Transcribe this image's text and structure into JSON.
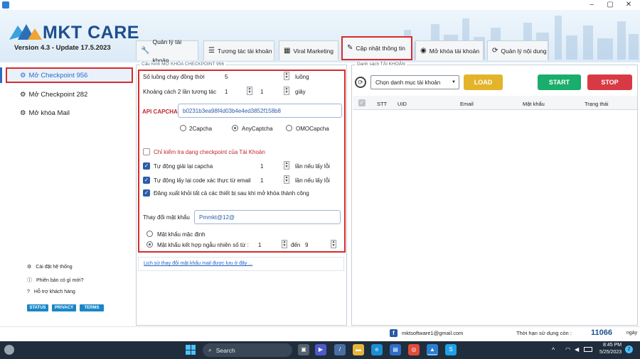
{
  "window": {
    "minimize": "–",
    "maximize": "▢",
    "close": "✕"
  },
  "brand": {
    "name": "MKT CARE",
    "version": "Version 4.3 - Update 17.5.2023"
  },
  "tabs": [
    {
      "label": "Quản lý tài khoản",
      "icon": "wrench-icon",
      "glyph": "🔧"
    },
    {
      "label": "Tương tác tài khoản",
      "icon": "list-icon",
      "glyph": "☰"
    },
    {
      "label": "Viral Marketing",
      "icon": "calendar-icon",
      "glyph": "▦"
    },
    {
      "label": "Cập nhật thông tin",
      "icon": "pencil-icon",
      "glyph": "✎"
    },
    {
      "label": "Mở khóa tài khoản",
      "icon": "user-icon",
      "glyph": "◉"
    },
    {
      "label": "Quản lý nội dung",
      "icon": "sync-icon",
      "glyph": "⟳"
    }
  ],
  "sidebar": {
    "items": [
      {
        "label": "Mở Checkpoint 956",
        "icon": "gear-icon",
        "glyph": "⚙"
      },
      {
        "label": "Mở Checkpoint 282",
        "icon": "gear-icon",
        "glyph": "⚙"
      },
      {
        "label": "Mở khóa Mail",
        "icon": "gear-icon",
        "glyph": "⚙"
      }
    ],
    "footer": [
      {
        "label": "Cài đặt hệ thống",
        "icon": "settings-icon",
        "glyph": "⚙"
      },
      {
        "label": "Phiên bản có gì mới?",
        "icon": "info-icon",
        "glyph": "ⓘ"
      },
      {
        "label": "Hỗ trợ khách hàng",
        "icon": "help-icon",
        "glyph": "?"
      }
    ],
    "pills": [
      "STATUS",
      "PRIVACY",
      "TERMS"
    ]
  },
  "config": {
    "legend": "Cấu hình MỞ KHÓA CHECKPOINT 956",
    "threads_label": "Số luồng chạy đồng thời",
    "threads_value": "5",
    "threads_unit": "luồng",
    "delay_label": "Khoảng cách 2 lần tương tác",
    "delay_from": "1",
    "delay_to": "1",
    "delay_unit": "giây",
    "api_label": "API CAPCHA",
    "api_value": "b0231b3ea98f4d03b4e4ed3852f158b8",
    "captcha_options": [
      "2Capcha",
      "AnyCaptcha",
      "OMOCapcha"
    ],
    "only_check_label": "Chỉ kiểm tra dạng checkpoint của Tài Khoản",
    "auto_captcha_label": "Tự động giải lại capcha",
    "auto_captcha_value": "1",
    "auto_captcha_unit": "lần nếu lấy lỗi",
    "auto_email_label": "Tự động lấy lại code xác thực từ email",
    "auto_email_value": "1",
    "auto_email_unit": "lần nếu lấy lỗi",
    "logout_label": "Đăng xuất khỏi tất cả các thiết bị sau khi mở khóa thành công",
    "pwd_label": "Thay đổi mật khẩu",
    "pwd_value": "Pmmkt@12@",
    "pwd_default_label": "Mật khẩu mặc định",
    "pwd_random_label": "Mật khẩu kết hợp ngẫu nhiên số từ :",
    "pwd_from": "1",
    "pwd_to_label": "đến",
    "pwd_to": "9",
    "history_link": "Lịch sử thay đổi mật khẩu mail được lưu ở đây ..."
  },
  "accounts": {
    "legend": "Danh sách TÀI KHOẢN",
    "category_placeholder": "Chọn danh mục tài khoản",
    "load": "LOAD",
    "start": "START",
    "stop": "STOP",
    "columns": [
      "STT",
      "UID",
      "Email",
      "Mật khẩu",
      "Trạng thái"
    ]
  },
  "status": {
    "email": "mktsoftware1@gmail.com",
    "expiry_label": "Thời hạn sử dụng còn :",
    "expiry_value": "11066",
    "expiry_unit": "ngày"
  },
  "taskbar": {
    "search": "Search",
    "time": "8:45 PM",
    "date": "5/25/2023",
    "notif": "2",
    "tray_arrow": "^"
  },
  "colors": {
    "accent": "#1d4f8e",
    "highlight": "#d62c2c",
    "load": "#e3b42a",
    "start": "#1aad6b",
    "stop": "#d83a45"
  }
}
